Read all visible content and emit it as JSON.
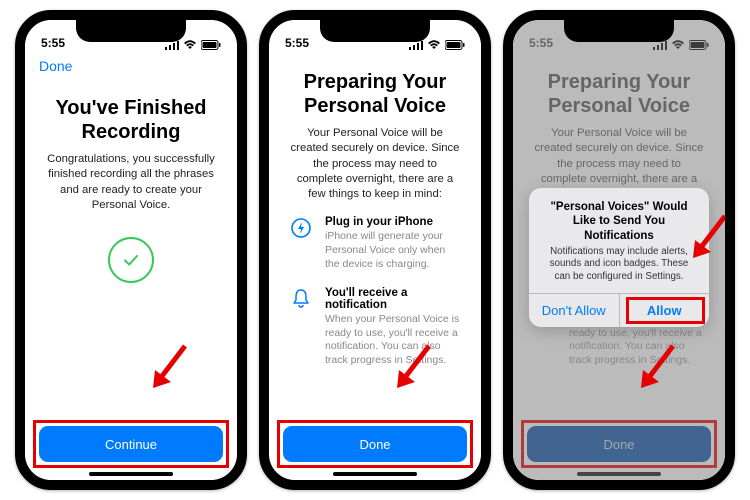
{
  "status": {
    "time": "5:55"
  },
  "screen1": {
    "nav_done": "Done",
    "title": "You've Finished Recording",
    "body": "Congratulations, you successfully finished recording all the phrases and are ready to create your Personal Voice.",
    "button": "Continue"
  },
  "screen2": {
    "title": "Preparing Your Personal Voice",
    "body": "Your Personal Voice will be created securely on device. Since the process may need to complete overnight, there are a few things to keep in mind:",
    "tip1_title": "Plug in your iPhone",
    "tip1_body": "iPhone will generate your Personal Voice only when the device is charging.",
    "tip2_title": "You'll receive a notification",
    "tip2_body": "When your Personal Voice is ready to use, you'll receive a notification. You can also track progress in Settings.",
    "button": "Done"
  },
  "screen3": {
    "title": "Preparing Your Personal Voice",
    "body": "Your Personal Voice will be created securely on device. Since the process may need to complete overnight, there are a few things to keep in mind:",
    "button": "Done",
    "alert_title": "\"Personal Voices\" Would Like to Send You Notifications",
    "alert_body": "Notifications may include alerts, sounds and icon badges. These can be configured in Settings.",
    "alert_deny": "Don't Allow",
    "alert_allow": "Allow"
  }
}
